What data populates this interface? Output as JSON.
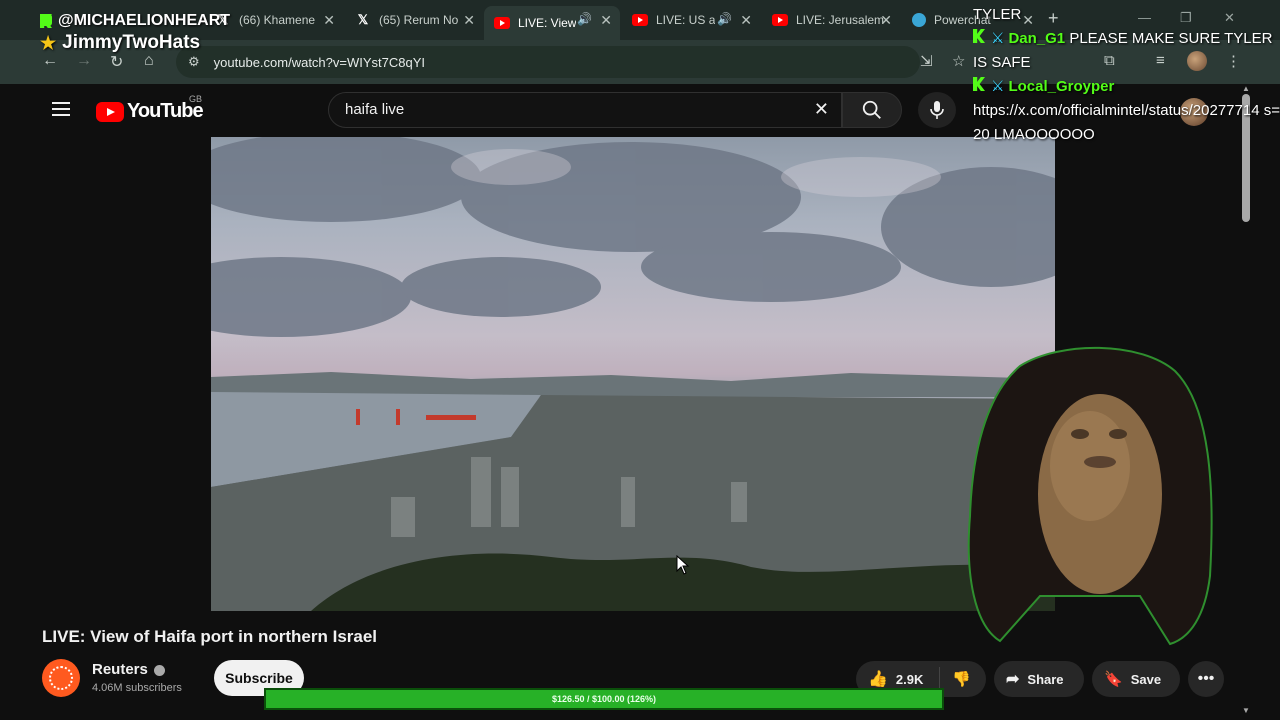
{
  "browser": {
    "tabs": [
      {
        "title": "",
        "icon": "kick-icon"
      },
      {
        "title": "(66) Khamene",
        "icon": "x-icon"
      },
      {
        "title": "(65) Rerum No",
        "icon": "x-icon"
      },
      {
        "title": "LIVE: View",
        "icon": "youtube-icon",
        "active": true
      },
      {
        "title": "LIVE: US a",
        "icon": "youtube-icon"
      },
      {
        "title": "LIVE: Jerusalem",
        "icon": "youtube-icon"
      },
      {
        "title": "Powerchat",
        "icon": "powerchat-icon"
      }
    ],
    "url": "youtube.com/watch?v=WIYst7C8qYI"
  },
  "youtube": {
    "logo_text": "YouTube",
    "region": "GB",
    "search_value": "haifa live",
    "video": {
      "title": "LIVE: View of Haifa port in northern Israel",
      "channel": "Reuters",
      "subscribers": "4.06M subscribers",
      "subscribe_label": "Subscribe",
      "likes": "2.9K",
      "share_label": "Share",
      "save_label": "Save"
    }
  },
  "overlay": {
    "top_user": "@MICHAELIONHEART",
    "top_name": "JimmyTwoHats",
    "chat": [
      {
        "user": "",
        "text": "TYLER"
      },
      {
        "user": "Dan_G1",
        "text": "PLEASE MAKE SURE TYLER IS SAFE"
      },
      {
        "user": "Local_Groyper",
        "text": "https://x.com/officialmintel/status/20277714 s=20 LMAOOOOOO"
      }
    ],
    "goal": {
      "text": "$126.50 / $100.00 (126%)",
      "fraction": 1.0
    }
  },
  "colors": {
    "youtube_red": "#ff0000",
    "kick_green": "#53fc18",
    "goal_green": "#27b127"
  }
}
